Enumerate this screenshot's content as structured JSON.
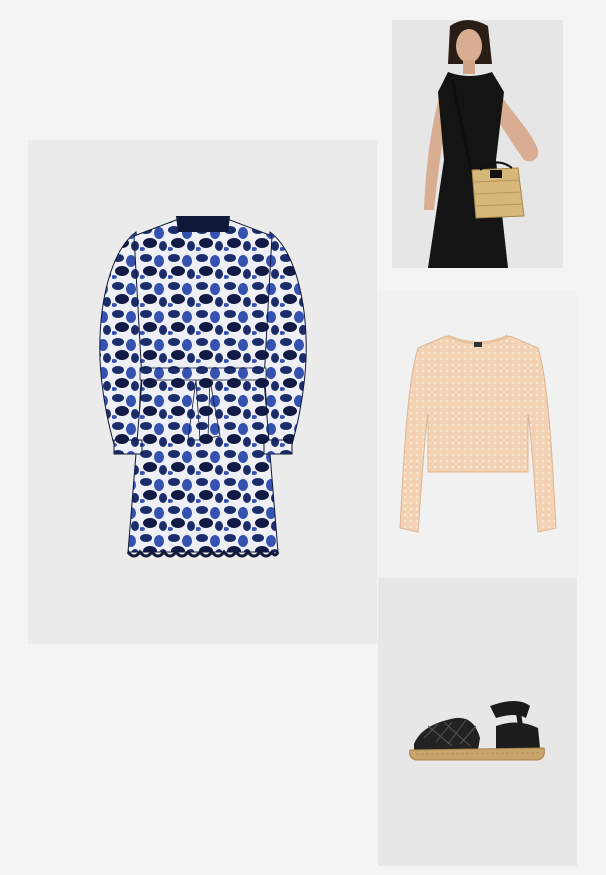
{
  "page": {
    "background": "#f4f4f4"
  },
  "products": [
    {
      "id": "dress",
      "icon": "printed-shirt-dress-image",
      "colors": {
        "primary": "#1c2d6b",
        "secondary": "#f3f3f6"
      }
    },
    {
      "id": "bag",
      "icon": "model-with-straw-bag-image",
      "colors": {
        "primary": "#141414",
        "secondary": "#d8b77a"
      }
    },
    {
      "id": "sweater",
      "icon": "knit-sweater-image",
      "colors": {
        "primary": "#f2d2b3"
      }
    },
    {
      "id": "shoe",
      "icon": "espadrille-sandal-image",
      "colors": {
        "primary": "#1a1a1a",
        "secondary": "#c9a56c"
      }
    }
  ]
}
